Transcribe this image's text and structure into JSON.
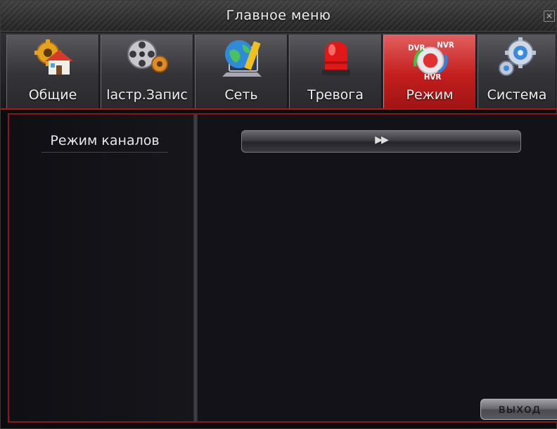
{
  "window": {
    "title": "Главное меню",
    "close_label": "✕"
  },
  "tabs": [
    {
      "label": "Общие",
      "icon": "home-gear-icon",
      "active": false
    },
    {
      "label": "lастр.Запис",
      "icon": "film-reel-icon",
      "active": false
    },
    {
      "label": "Сеть",
      "icon": "globe-laptop-icon",
      "active": false
    },
    {
      "label": "Тревога",
      "icon": "alarm-siren-icon",
      "active": false
    },
    {
      "label": "Режим",
      "icon": "dvr-nvr-hvr-icon",
      "active": true
    },
    {
      "label": "Система",
      "icon": "gears-icon",
      "active": false
    }
  ],
  "mode_icon_text": {
    "dvr": "DVR",
    "nvr": "NVR",
    "hvr": "HVR"
  },
  "sidebar": {
    "items": [
      {
        "label": "Режим каналов",
        "selected": true
      }
    ]
  },
  "main": {
    "channel_selector": {
      "arrows": "▶▶"
    }
  },
  "footer": {
    "exit_label": "выход"
  },
  "colors": {
    "accent": "#c41e1e",
    "panel": "#121218",
    "tab": "#343438"
  }
}
